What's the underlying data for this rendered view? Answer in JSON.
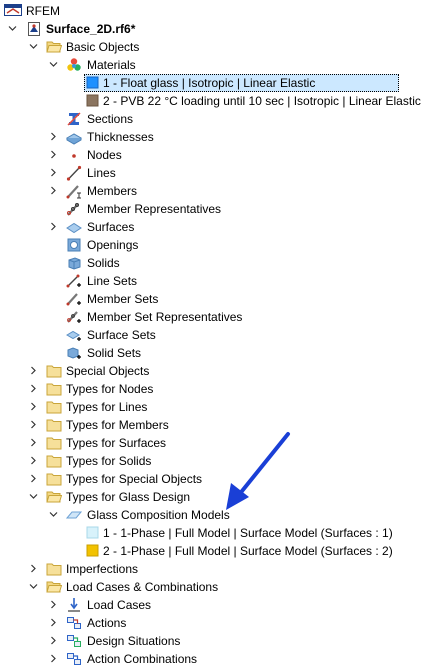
{
  "tree": {
    "root": "RFEM",
    "file": "Surface_2D.rf6*",
    "basic_objects": "Basic Objects",
    "materials": "Materials",
    "material_1": "1 - Float glass | Isotropic | Linear Elastic",
    "material_2": "2 - PVB 22 °C loading until 10 sec | Isotropic | Linear Elastic",
    "sections": "Sections",
    "thicknesses": "Thicknesses",
    "nodes": "Nodes",
    "lines": "Lines",
    "members": "Members",
    "member_representatives": "Member Representatives",
    "surfaces": "Surfaces",
    "openings": "Openings",
    "solids": "Solids",
    "line_sets": "Line Sets",
    "member_sets": "Member Sets",
    "member_set_representatives": "Member Set Representatives",
    "surface_sets": "Surface Sets",
    "solid_sets": "Solid Sets",
    "special_objects": "Special Objects",
    "types_nodes": "Types for Nodes",
    "types_lines": "Types for Lines",
    "types_members": "Types for Members",
    "types_surfaces": "Types for Surfaces",
    "types_solids": "Types for Solids",
    "types_special": "Types for Special Objects",
    "types_glass": "Types for Glass Design",
    "glass_models": "Glass Composition Models",
    "glass_model_1": "1 - 1-Phase | Full Model | Surface Model (Surfaces : 1)",
    "glass_model_2": "2 - 1-Phase | Full Model | Surface Model (Surfaces : 2)",
    "imperfections": "Imperfections",
    "load_cases_combinations": "Load Cases & Combinations",
    "load_cases": "Load Cases",
    "actions": "Actions",
    "design_situations": "Design Situations",
    "action_combinations": "Action Combinations"
  },
  "colors": {
    "material_1": "#1e90ff",
    "material_2": "#8b7560",
    "glass_model_1": "#d8f2fb",
    "glass_model_2": "#f2c200",
    "annotation_arrow": "#1a3fd6",
    "selection": "#cce8ff"
  }
}
